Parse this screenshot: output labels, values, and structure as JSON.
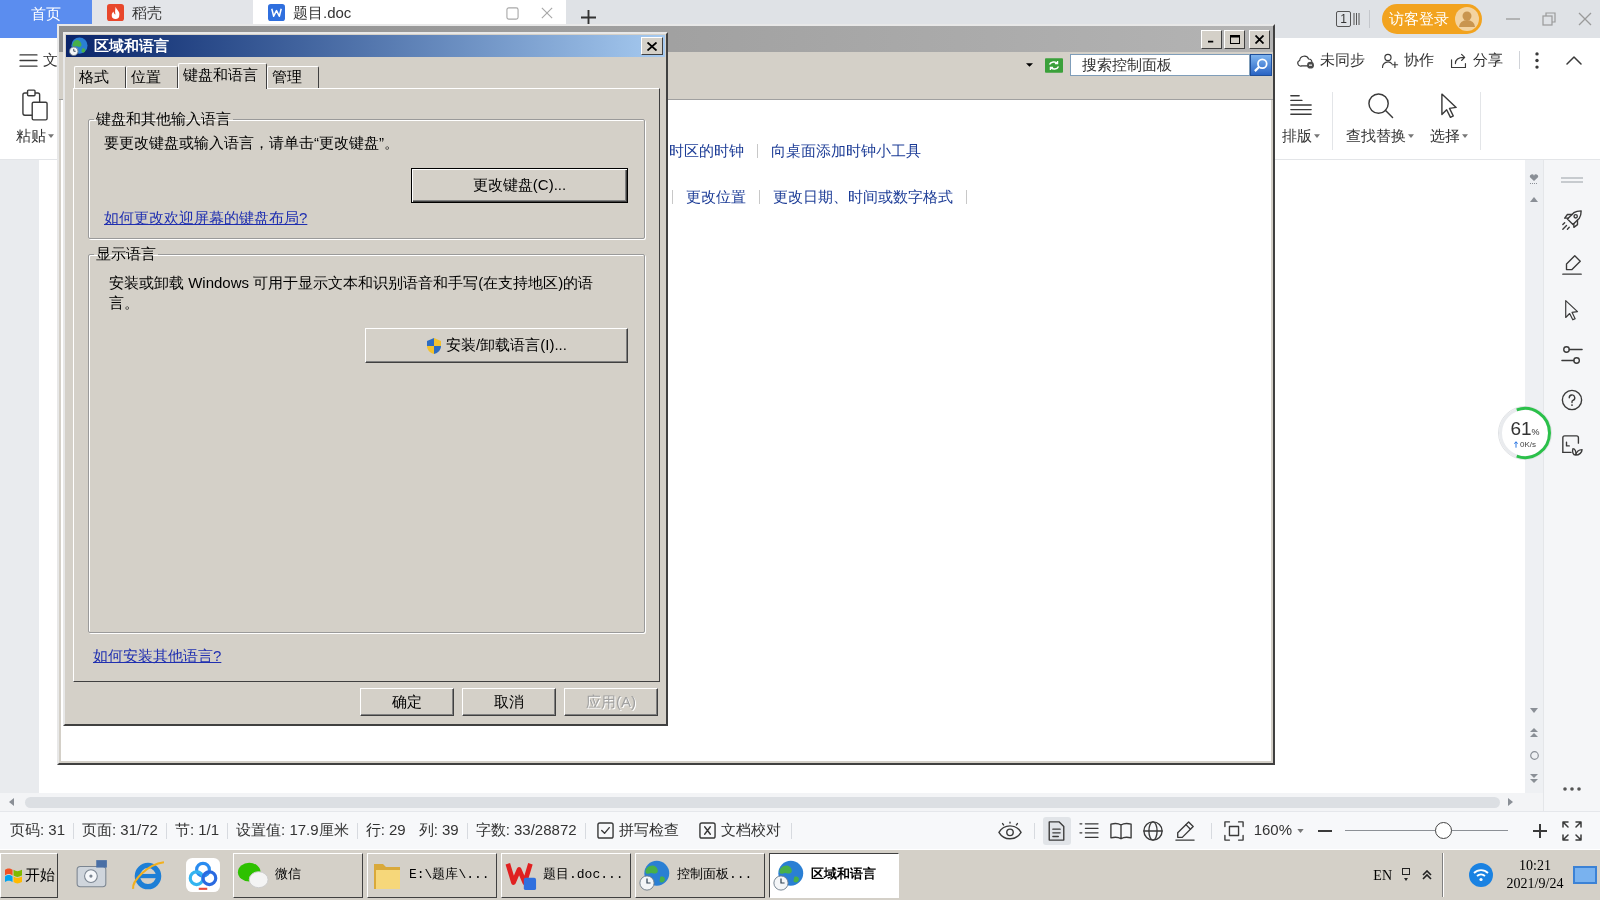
{
  "wps": {
    "tabs": [
      {
        "label": "首页",
        "kind": "home",
        "selected": false
      },
      {
        "label": "稻壳",
        "kind": "tab",
        "selected": false
      },
      {
        "label": "题目.doc",
        "kind": "tab",
        "selected": true
      }
    ],
    "window_count": "1",
    "login_button": "访客登录"
  },
  "toolbar": {
    "menu_label": "文",
    "actions": [
      "未同步",
      "协作",
      "分享"
    ]
  },
  "ribbon": {
    "left": [
      "粘贴"
    ],
    "right": [
      "排版",
      "查找替换",
      "选择"
    ]
  },
  "control_panel": {
    "search": {
      "placeholder": "搜索控制面板"
    },
    "link_rows": [
      [
        "时区的时钟",
        "向桌面添加时钟小工具"
      ],
      [
        "更改位置",
        "更改日期、时间或数字格式"
      ]
    ]
  },
  "dialog": {
    "title": "区域和语言",
    "tabs": [
      {
        "label": "格式",
        "selected": false
      },
      {
        "label": "位置",
        "selected": false
      },
      {
        "label": "键盘和语言",
        "selected": true
      },
      {
        "label": "管理",
        "selected": false
      }
    ],
    "groups": [
      {
        "title": "键盘和其他输入语言",
        "text": "要更改键盘或输入语言，请单击“更改键盘”。",
        "button": {
          "label": "更改键盘(C)...",
          "default": true,
          "shield": false
        },
        "link": "如何更改欢迎屏幕的键盘布局?"
      },
      {
        "title": "显示语言",
        "text": "安装或卸载 Windows 可用于显示文本和识别语音和手写(在支持地区)的语言。",
        "button": {
          "label": "安装/卸载语言(I)...",
          "default": false,
          "shield": true
        }
      }
    ],
    "footer_link": "如何安装其他语言?",
    "buttons": [
      {
        "label": "确定",
        "disabled": false
      },
      {
        "label": "取消",
        "disabled": false
      },
      {
        "label": "应用(A)",
        "disabled": true
      }
    ]
  },
  "side_meter": {
    "percent": "61",
    "unit": "%",
    "speed": "0K/s",
    "level": 0.61
  },
  "status_bar": {
    "item_groups": [
      [
        "页码: 31"
      ],
      [
        "页面: 31/72"
      ],
      [
        "节: 1/1"
      ],
      [
        "设置值: 17.9厘米"
      ],
      [
        "行: 29",
        "列: 39"
      ],
      [
        "字数: 33/28872"
      ]
    ],
    "tools": [
      "拼写检查",
      "文档校对"
    ],
    "view_modes": [
      {
        "selected": true
      },
      {
        "selected": false
      },
      {
        "selected": false
      },
      {
        "selected": false
      },
      {
        "selected": false
      }
    ],
    "zoom": {
      "reading": "160%",
      "level": 0.6
    }
  },
  "taskbar": {
    "start": "开始",
    "tasks": [
      {
        "label": "微信",
        "selected": false
      },
      {
        "label": "E:\\题库\\...",
        "selected": false
      },
      {
        "label": "题目.doc...",
        "selected": false
      },
      {
        "label": "控制面板...",
        "selected": false
      },
      {
        "label": "区域和语言",
        "selected": true
      }
    ],
    "language": "EN",
    "time": "10:21",
    "date": "2021/9/24"
  }
}
